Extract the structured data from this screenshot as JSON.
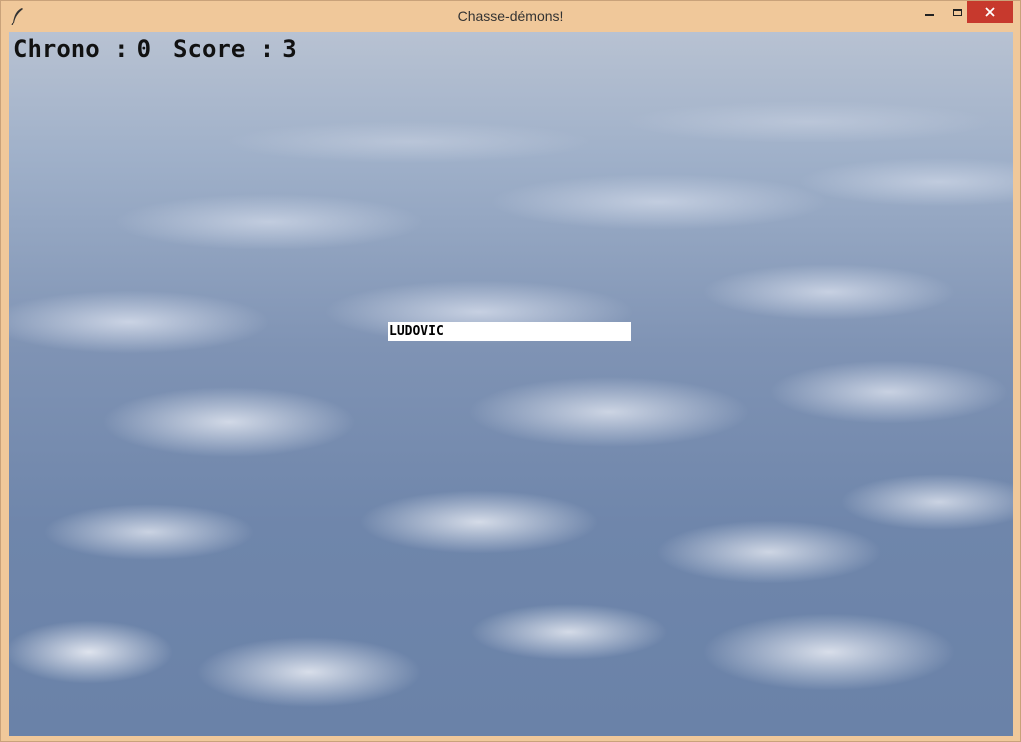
{
  "window": {
    "title": "Chasse-démons!",
    "app_icon": "feather-icon",
    "controls": [
      "minimize-icon",
      "maximize-icon",
      "close-icon"
    ],
    "colors": {
      "frame": "#f0c89a",
      "close_button": "#c7392d"
    }
  },
  "hud": {
    "chrono_label": "Chrono :",
    "chrono_value": "0",
    "score_label": "Score :",
    "score_value": "3"
  },
  "name_input": {
    "value": "LUDOVIC"
  }
}
